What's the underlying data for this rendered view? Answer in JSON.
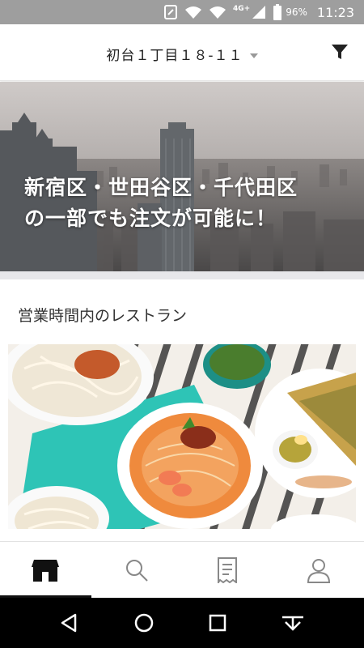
{
  "status_bar": {
    "network_label": "4G+",
    "battery": "96%",
    "time": "11:23",
    "icons": [
      "nfc-icon",
      "wifi-calling-icon",
      "wifi-icon",
      "signal-icon",
      "battery-icon"
    ]
  },
  "header": {
    "address": "初台１丁目１８-１１",
    "filter_icon": "filter-icon"
  },
  "hero": {
    "line1": "新宿区・世田谷区・千代田区",
    "line2": "の一部でも注文が可能に！"
  },
  "section": {
    "title": "営業時間内のレストラン"
  },
  "bottom_nav": {
    "items": [
      {
        "icon": "store-icon",
        "active": true
      },
      {
        "icon": "search-icon",
        "active": false
      },
      {
        "icon": "receipt-icon",
        "active": false
      },
      {
        "icon": "account-icon",
        "active": false
      }
    ]
  },
  "system_nav": {
    "items": [
      "back-icon",
      "home-icon",
      "recents-icon",
      "notification-pull-icon"
    ]
  },
  "colors": {
    "status_bar": "#9e9e9e",
    "divider": "#e7e7ea",
    "accent": "#111111"
  }
}
